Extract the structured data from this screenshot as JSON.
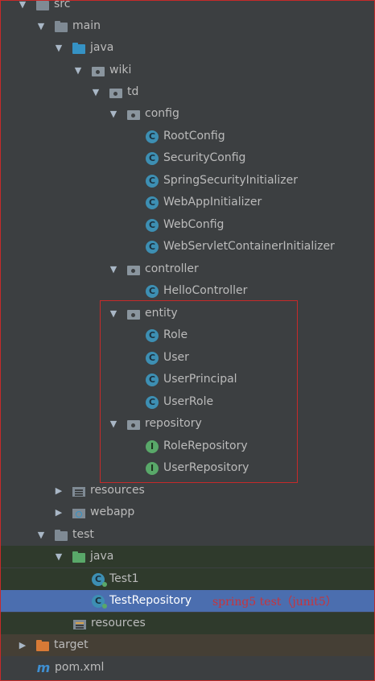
{
  "tree": {
    "src": "src",
    "main": "main",
    "main_java": "java",
    "wiki": "wiki",
    "td": "td",
    "config": "config",
    "config_items": [
      "RootConfig",
      "SecurityConfig",
      "SpringSecurityInitializer",
      "WebAppInitializer",
      "WebConfig",
      "WebServletContainerInitializer"
    ],
    "controller": "controller",
    "controller_items": [
      "HelloController"
    ],
    "entity": "entity",
    "entity_items": [
      "Role",
      "User",
      "UserPrincipal",
      "UserRole"
    ],
    "repository": "repository",
    "repository_items": [
      "RoleRepository",
      "UserRepository"
    ],
    "main_resources": "resources",
    "webapp": "webapp",
    "test": "test",
    "test_java": "java",
    "test1": "Test1",
    "test_repository": "TestRepository",
    "test_resources": "resources",
    "target": "target",
    "pom": "pom.xml"
  },
  "annotation": "spring5 test（junit5）",
  "icons": {
    "class": "C",
    "interface": "I",
    "maven": "m"
  },
  "colors": {
    "background": "#3c3f41",
    "selection": "#4b6eaf",
    "test_source_bg": "#2f3a2c",
    "excluded_bg": "#453f35",
    "highlight_border": "#c62a2a",
    "annotation": "#c9333a"
  }
}
